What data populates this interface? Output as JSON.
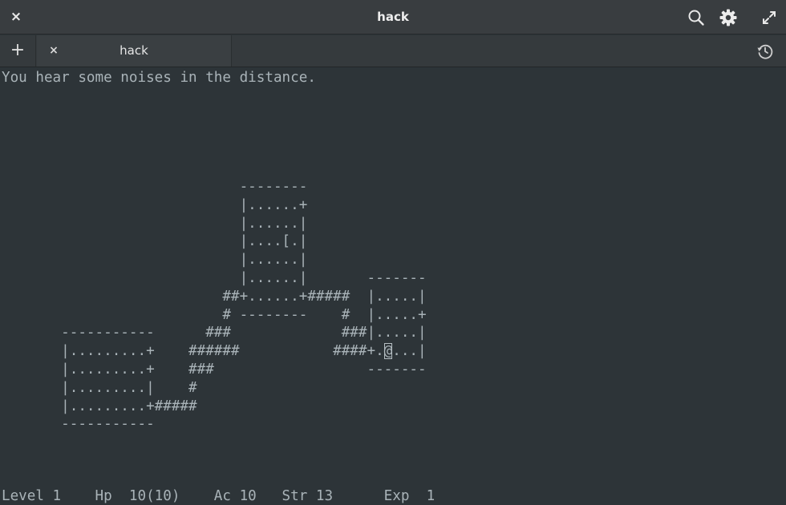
{
  "window": {
    "title": "hack",
    "close_glyph": "×",
    "icons": [
      "close-icon",
      "search-icon",
      "gear-icon",
      "fullscreen-icon"
    ]
  },
  "tabs": {
    "new_tab_glyph": "+",
    "items": [
      {
        "label": "hack",
        "close_glyph": "×"
      }
    ],
    "history_icon": "history-icon"
  },
  "terminal": {
    "message": "You hear some noises in the distance.",
    "map_lines": [
      "                            --------",
      "                            |......+",
      "                            |......|",
      "                            |....[.|",
      "                            |......|",
      "                            |......|       -------",
      "                          ##+......+#####  |.....|",
      "                          # --------    #  |.....+",
      "       -----------      ###             ###|.....|",
      "       |...<.....|    ######           ####+.",
      "       |.........+    ###                  -------",
      "       |.........|    #",
      "       |.........+#####",
      "       -----------"
    ],
    "player_row_before": "       |.........+    ######           ####+.",
    "player_glyph": "@",
    "player_row_after": "...|",
    "status_line": "Level 1    Hp  10(10)    Ac 10   Str 13      Exp  1",
    "colors": {
      "background": "#2d3438",
      "foreground": "#a9b3b8"
    }
  }
}
